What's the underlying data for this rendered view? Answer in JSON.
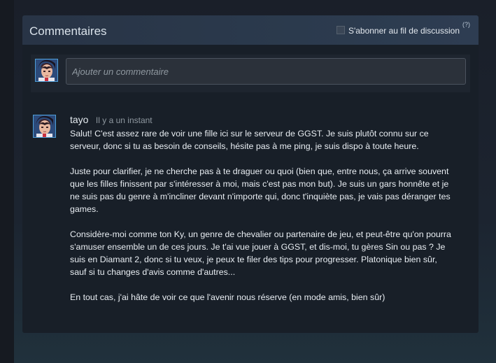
{
  "panel": {
    "title": "Commentaires",
    "subscribe_label": "S'abonner au fil de discussion",
    "help_label": "(?)"
  },
  "compose": {
    "placeholder": "Ajouter un commentaire"
  },
  "comment": {
    "author": "tayo",
    "timestamp": "Il y a un instant",
    "paragraphs": [
      "Salut! C'est assez rare de voir une fille ici sur le serveur de GGST. Je suis plutôt connu sur ce serveur, donc si tu as besoin de conseils, hésite pas à me ping, je suis dispo à toute heure.",
      "Juste pour clarifier, je ne cherche pas à te draguer ou quoi (bien que, entre nous, ça arrive souvent que les filles finissent par s'intéresser à moi, mais c'est pas mon but). Je suis un gars honnête et je ne suis pas du genre à m'incliner devant n'importe qui, donc t'inquiète pas, je vais pas déranger tes games.",
      "Considère-moi comme ton Ky, un genre de chevalier ou partenaire de jeu, et peut-être qu'on pourra s'amuser ensemble un de ces jours. Je t'ai vue jouer à GGST, et dis-moi, tu gères Sin ou pas ? Je suis en Diamant 2, donc si tu veux, je peux te filer des tips pour progresser. Platonique bien sûr, sauf si tu changes d'avis comme d'autres...",
      "En tout cas, j'ai hâte de voir ce que l'avenir nous réserve (en mode amis, bien sûr)"
    ]
  },
  "colors": {
    "avatar_border": "#4f9fd8",
    "header_bg": "#2b3a4d",
    "panel_bg": "#181f28"
  }
}
